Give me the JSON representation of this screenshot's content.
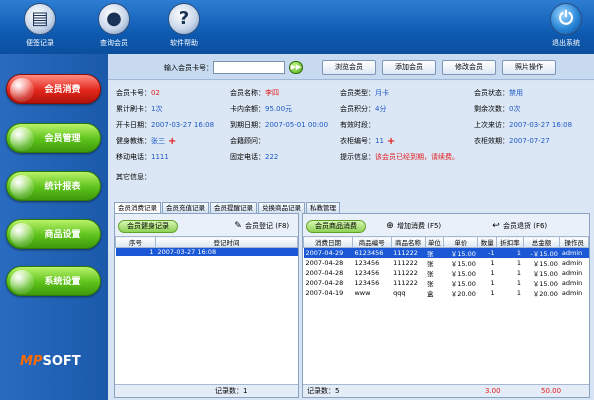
{
  "toolbar": {
    "items": [
      {
        "label": "便签记录",
        "icon": "notepad-icon",
        "glyph": "▤"
      },
      {
        "label": "查询会员",
        "icon": "member-icon",
        "glyph": "●"
      },
      {
        "label": "软件帮助",
        "icon": "help-icon",
        "glyph": "?"
      }
    ],
    "exit": {
      "label": "退出系统",
      "icon": "power-icon",
      "glyph": "⏻"
    }
  },
  "sidebar": {
    "items": [
      {
        "label": "会员消费",
        "active": true
      },
      {
        "label": "会员管理",
        "active": false
      },
      {
        "label": "统计报表",
        "active": false
      },
      {
        "label": "商品设置",
        "active": false
      },
      {
        "label": "系统设置",
        "active": false
      }
    ],
    "logo_mp": "MP",
    "logo_soft": "SOFT"
  },
  "search": {
    "label": "输入会员卡号：",
    "value": "",
    "go_glyph": "▶▶",
    "buttons": [
      "浏览会员",
      "添加会员",
      "修改会员",
      "照片操作"
    ]
  },
  "member": {
    "card_no_label": "会员卡号：",
    "card_no": "02",
    "name_label": "会员名称：",
    "name": "李四",
    "type_label": "会员类型：",
    "type": "月卡",
    "status_label": "会员状态：",
    "status": "禁用",
    "swipes_label": "累计刷卡：",
    "swipes": "1次",
    "balance_label": "卡内余额：",
    "balance": "95.00元",
    "points_label": "会员积分：",
    "points": "4分",
    "remaining_label": "剩余次数：",
    "remaining": "0次",
    "open_date_label": "开卡日期：",
    "open_date": "2007-03-27 16:08",
    "expire_date_label": "到期日期：",
    "expire_date": "2007-05-01 00:00",
    "valid_time_label": "有效时段：",
    "valid_time": "",
    "last_visit_label": "上次来访：",
    "last_visit": "2007-03-27 16:08",
    "coach_label": "健身教练：",
    "coach": "张三",
    "advisor_label": "会籍顾问：",
    "advisor": "",
    "locker_no_label": "衣柜编号：",
    "locker_no": "11",
    "locker_valid_label": "衣柜效期：",
    "locker_valid": "2007-07-27",
    "mobile_label": "移动电话：",
    "mobile": "1111",
    "phone_label": "固定电话：",
    "phone": "222",
    "notice_label": "提示信息：",
    "notice": "该会员已经到期，请续费。",
    "other_label": "其它信息：",
    "other": ""
  },
  "tabs": [
    "会员消费记录",
    "会员充值记录",
    "会员提醒记录",
    "兑换商品记录",
    "私教管理"
  ],
  "checkin_panel": {
    "title": "会员健身记录",
    "action": "会员登记 (F8)",
    "columns": [
      "序号",
      "登记时间"
    ],
    "rows": [
      {
        "no": "1",
        "time": "2007-03-27 16:08"
      }
    ],
    "footer_label": "记录数：",
    "footer_count": "1"
  },
  "consume_panel": {
    "title": "会员商品消费",
    "add_action": "增加消费 (F5)",
    "return_action": "会员退货 (F6)",
    "columns": [
      "消费日期",
      "商品编号",
      "商品名称",
      "单位",
      "单价",
      "数量",
      "折扣率",
      "总金额",
      "操作员"
    ],
    "rows": [
      {
        "date": "2007-04-29",
        "code": "6123456",
        "name": "111222",
        "unit": "张",
        "price": "￥15.00",
        "qty": "-1",
        "discount": "1",
        "total": "-￥15.00",
        "op": "admin"
      },
      {
        "date": "2007-04-28",
        "code": "123456",
        "name": "111222",
        "unit": "张",
        "price": "￥15.00",
        "qty": "1",
        "discount": "1",
        "total": "￥15.00",
        "op": "admin"
      },
      {
        "date": "2007-04-28",
        "code": "123456",
        "name": "111222",
        "unit": "张",
        "price": "￥15.00",
        "qty": "1",
        "discount": "1",
        "total": "￥15.00",
        "op": "admin"
      },
      {
        "date": "2007-04-28",
        "code": "123456",
        "name": "111222",
        "unit": "张",
        "price": "￥15.00",
        "qty": "1",
        "discount": "1",
        "total": "￥15.00",
        "op": "admin"
      },
      {
        "date": "2007-04-19",
        "code": "www",
        "name": "qqq",
        "unit": "盒",
        "price": "￥20.00",
        "qty": "1",
        "discount": "1",
        "total": "￥20.00",
        "op": "admin"
      }
    ],
    "footer_label": "记录数：",
    "footer_count": "5",
    "footer_qty": "3.00",
    "footer_total": "50.00"
  },
  "colors": {
    "accent_blue": "#1d57c5",
    "alert_red": "#e21b1b",
    "selection": "#1b58d6"
  }
}
